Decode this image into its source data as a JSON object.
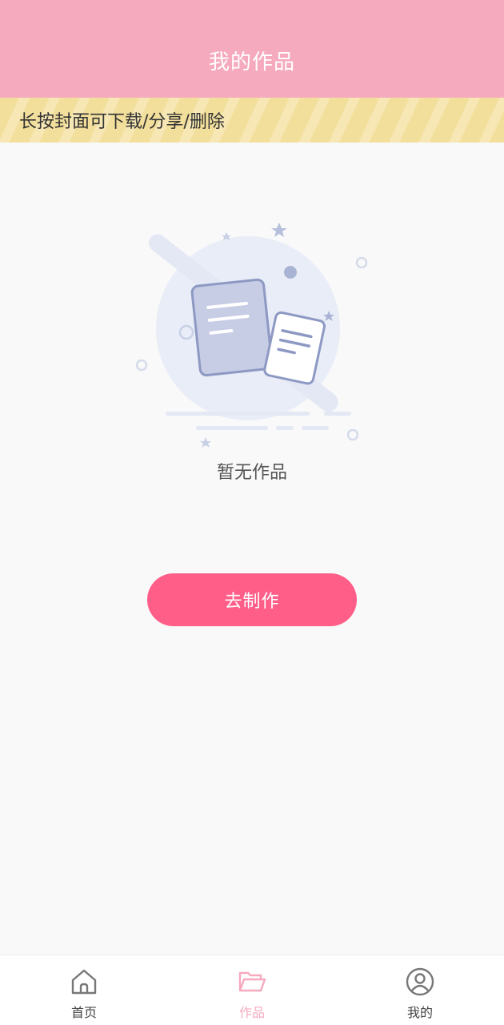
{
  "header": {
    "title": "我的作品"
  },
  "tip": {
    "text": "长按封面可下载/分享/删除"
  },
  "empty_state": {
    "message": "暂无作品",
    "illustration_icon": "empty-documents-icon"
  },
  "action": {
    "make_label": "去制作"
  },
  "tabbar": {
    "tabs": [
      {
        "label": "首页",
        "icon": "home-icon",
        "active": false
      },
      {
        "label": "作品",
        "icon": "folder-open-icon",
        "active": true
      },
      {
        "label": "我的",
        "icon": "user-circle-icon",
        "active": false
      }
    ]
  },
  "colors": {
    "header_bg": "#f5aabe",
    "tip_bg": "#f3df9c",
    "button_bg": "#fe5e88",
    "active_tab": "#f5aabe"
  }
}
